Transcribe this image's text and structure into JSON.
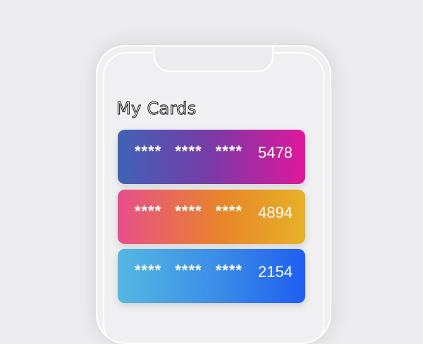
{
  "screen": {
    "title": "My Cards"
  },
  "cards": [
    {
      "masked": [
        "****",
        "****",
        "****"
      ],
      "last4": "5478"
    },
    {
      "masked": [
        "****",
        "****",
        "****"
      ],
      "last4": "4894"
    },
    {
      "masked": [
        "****",
        "****",
        "****"
      ],
      "last4": "2154"
    }
  ]
}
